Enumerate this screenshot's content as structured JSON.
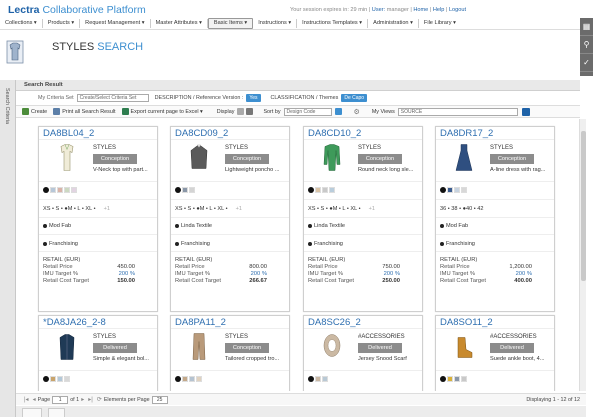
{
  "header": {
    "brand_1": "Lectra",
    "brand_2": "Collaborative Platform",
    "session_text": "Your session expires in: 29 min |",
    "user_label": "User:",
    "user_name": "manager",
    "home_link": "Home",
    "help_link": "Help",
    "logout_link": "Logout"
  },
  "menu": [
    {
      "label": "Collections ▾"
    },
    {
      "label": "Products ▾"
    },
    {
      "label": "Request Management ▾"
    },
    {
      "label": "Master Attributes ▾"
    },
    {
      "label": "Basic Items ▾"
    },
    {
      "label": "Instructions ▾"
    },
    {
      "label": "Instructions Templates ▾"
    },
    {
      "label": "Administration ▾"
    },
    {
      "label": "File Library ▾"
    }
  ],
  "page": {
    "title_1": "STYLES",
    "title_2": "SEARCH",
    "side_tab": "Search Criteria"
  },
  "search_result": {
    "header": "Search Result",
    "criteria_label": "My Criteria Set",
    "criteria_value": "Create/Select Criteria Set",
    "desc_label": "DESCRIPTION / Reference Version :",
    "desc_value": "Yes",
    "class_label": "CLASSIFICATION / Themes",
    "class_value": "De Capo"
  },
  "toolbar": {
    "create": "Create",
    "print": "Print all Search Result",
    "export": "Export current page to Excel ▾",
    "display": "Display",
    "sort_label": "Sort by",
    "sort_value": "Design Code",
    "views_label": "My Views",
    "views_value": "SOURCE"
  },
  "cards": [
    {
      "code": "DA8BL04_2",
      "category": "STYLES",
      "status": "Conception",
      "description": "V-Neck top with part...",
      "sizes": "XS • S • ●M • L • XL •",
      "sizes_more": "+1",
      "supplier": "Mod Fab",
      "franchising": "Franchising",
      "retail_title": "RETAIL (EUR)",
      "retail_price_label": "Retail Price",
      "retail_price": "450.00",
      "imu_label": "IMU Target %",
      "imu": "200 %",
      "cost_label": "Retail Cost Target",
      "cost": "150.00",
      "swatches": [
        "#222222",
        "#b7c7d8",
        "#d9b3a8",
        "#ccd9c2",
        "#e2d4e2"
      ],
      "garment": "top"
    },
    {
      "code": "DA8CD09_2",
      "category": "STYLES",
      "status": "Conception",
      "description": "Lightweight poncho ...",
      "sizes": "XS • S • ●M • L • XL •",
      "sizes_more": "+1",
      "supplier": "Linda Textile",
      "franchising": "Franchising",
      "retail_title": "RETAIL (EUR)",
      "retail_price_label": "Retail Price",
      "retail_price": "800.00",
      "imu_label": "IMU Target %",
      "imu": "200 %",
      "cost_label": "Retail Cost Target",
      "cost": "266.67",
      "swatches": [
        "#222222",
        "#8a97a8",
        "#d4d4d4"
      ],
      "garment": "poncho"
    },
    {
      "code": "DA8CD10_2",
      "category": "STYLES",
      "status": "Conception",
      "description": "Round neck long sle...",
      "sizes": "XS • S • ●M • L • XL •",
      "sizes_more": "+1",
      "supplier": "Linda Textile",
      "franchising": "Franchising",
      "retail_title": "RETAIL (EUR)",
      "retail_price_label": "Retail Price",
      "retail_price": "750.00",
      "imu_label": "IMU Target %",
      "imu": "200 %",
      "cost_label": "Retail Cost Target",
      "cost": "250.00",
      "swatches": [
        "#222222",
        "#d9c4a8",
        "#c9c9c9",
        "#b9cddc"
      ],
      "garment": "sweater"
    },
    {
      "code": "DA8DR17_2",
      "category": "STYLES",
      "status": "Conception",
      "description": "A-line dress with rag...",
      "sizes": "36 • 38 • ●40 • 42",
      "sizes_more": "",
      "supplier": "Mod Fab",
      "franchising": "Franchising",
      "retail_title": "RETAIL (EUR)",
      "retail_price_label": "Retail Price",
      "retail_price": "1,200.00",
      "imu_label": "IMU Target %",
      "imu": "200 %",
      "cost_label": "Retail Cost Target",
      "cost": "400.00",
      "swatches": [
        "#222222",
        "#3b5c8f",
        "#c7d3e0",
        "#d8d8d8"
      ],
      "garment": "dress"
    },
    {
      "code": "*DA8JA26_2-8",
      "category": "STYLES",
      "status": "Delivered",
      "description": "Simple & elegant bol...",
      "swatches": [
        "#222222",
        "#c9a46b",
        "#b4c9d9",
        "#d8d8d8"
      ],
      "garment": "jacket"
    },
    {
      "code": "DA8PA11_2",
      "category": "STYLES",
      "status": "Conception",
      "description": "Tailored cropped tro...",
      "swatches": [
        "#222222",
        "#c4a98a",
        "#b5c3d1",
        "#e0d2c0"
      ],
      "garment": "pants"
    },
    {
      "code": "DA8SC26_2",
      "category": "#ACCESSORIES",
      "status": "Delivered",
      "description": "Jersey Snood Scarf",
      "swatches": [
        "#222222",
        "#c9b8a5",
        "#b9c9d5"
      ],
      "garment": "scarf"
    },
    {
      "code": "DA8SO11_2",
      "category": "#ACCESSORIES",
      "status": "Delivered",
      "description": "Suede ankle boot, 4...",
      "swatches": [
        "#222222",
        "#d9b23a",
        "#8a97a8",
        "#c9c9c9"
      ],
      "garment": "boot"
    }
  ],
  "pager": {
    "page_label": "Page",
    "page_value": "1",
    "of_label": "of 1",
    "per_page_label": "Elements per Page",
    "per_page_value": "25",
    "displaying": "Displaying 1 - 12 of 12"
  },
  "colors": {
    "brand_blue": "#1e62a8",
    "accent_blue": "#3d8fd0",
    "status_grey": "#8c8c8c"
  }
}
